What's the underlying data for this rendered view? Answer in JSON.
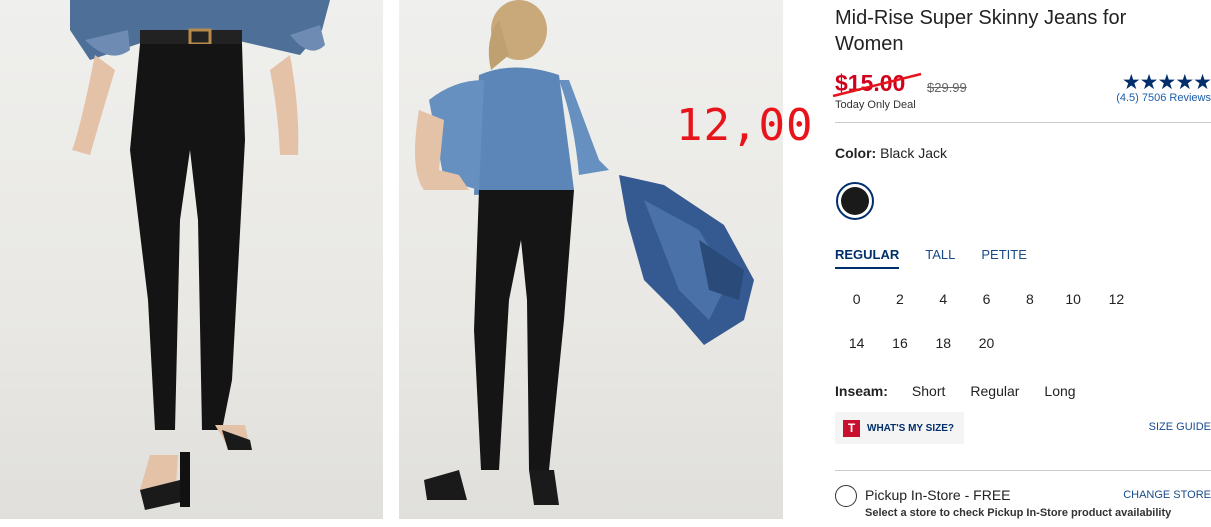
{
  "handwritten_note": "12,00",
  "product": {
    "title": "Mid-Rise Super Skinny Jeans for Women",
    "price": "$15.00",
    "original_price": "$29.99",
    "deal_label": "Today Only Deal",
    "rating_stars": "★★★★★",
    "reviews": "(4.5) 7506 Reviews",
    "rating_value": 4.5
  },
  "color": {
    "label": "Color:",
    "value": "Black Jack",
    "swatch_color": "#1a1a1a"
  },
  "fit_tabs": [
    {
      "label": "REGULAR",
      "active": true
    },
    {
      "label": "TALL",
      "active": false
    },
    {
      "label": "PETITE",
      "active": false
    }
  ],
  "sizes": [
    "0",
    "2",
    "4",
    "6",
    "8",
    "10",
    "12",
    "14",
    "16",
    "18",
    "20"
  ],
  "inseam": {
    "label": "Inseam:",
    "options": [
      "Short",
      "Regular",
      "Long"
    ]
  },
  "whats_my_size": {
    "icon_letter": "T",
    "label": "WHAT'S MY SIZE?"
  },
  "size_guide": "SIZE GUIDE",
  "pickup": {
    "label": "Pickup In-Store - FREE",
    "change_store": "CHANGE STORE",
    "note": "Select a store to check Pickup In-Store product availability"
  },
  "colors": {
    "sale_red": "#d0021b",
    "navy": "#002f6c",
    "handwriting_red": "#e8141b"
  }
}
